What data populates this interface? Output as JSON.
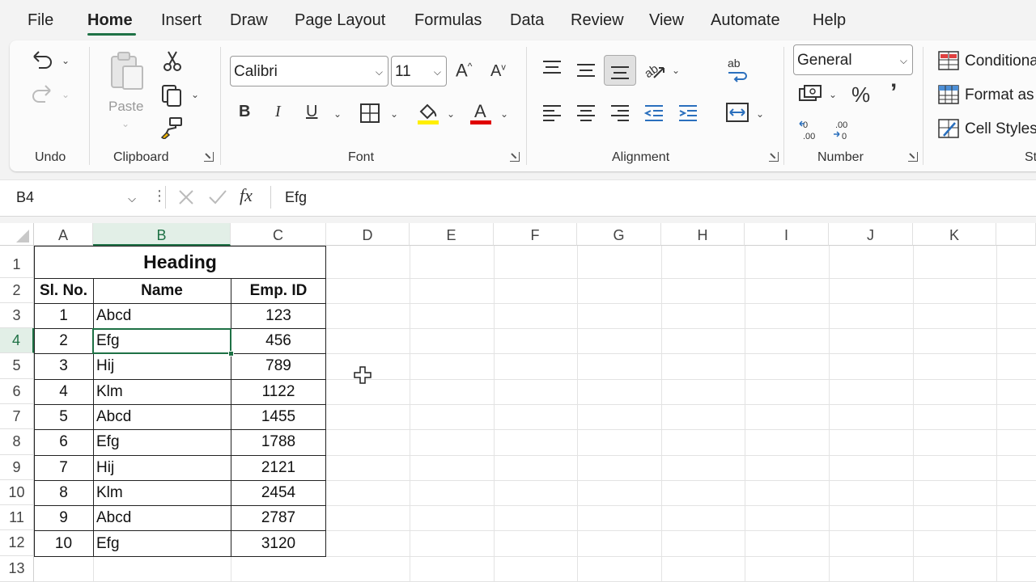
{
  "menu": [
    "File",
    "Home",
    "Insert",
    "Draw",
    "Page Layout",
    "Formulas",
    "Data",
    "Review",
    "View",
    "Automate",
    "Help"
  ],
  "ribbon": {
    "groups": {
      "undo": "Undo",
      "clipboard": "Clipboard",
      "font": "Font",
      "alignment": "Alignment",
      "number": "Number",
      "styles": "St"
    },
    "paste_label": "Paste",
    "font_name": "Calibri",
    "font_size": "11",
    "number_format": "General",
    "styles_items": [
      "Conditiona",
      "Format as",
      "Cell Styles"
    ],
    "bold": "B",
    "italic": "I",
    "underline": "U"
  },
  "formula_bar": {
    "name_box": "B4",
    "fx": "fx",
    "content": "Efg"
  },
  "columns": [
    "A",
    "B",
    "C",
    "D",
    "E",
    "F",
    "G",
    "H",
    "I",
    "J",
    "K"
  ],
  "rows": [
    "1",
    "2",
    "3",
    "4",
    "5",
    "6",
    "7",
    "8",
    "9",
    "10",
    "11",
    "12",
    "13"
  ],
  "sheet": {
    "heading": "Heading",
    "headers": [
      "Sl. No.",
      "Name",
      "Emp. ID"
    ],
    "data": [
      [
        "1",
        "Abcd",
        "123"
      ],
      [
        "2",
        "Efg",
        "456"
      ],
      [
        "3",
        "Hij",
        "789"
      ],
      [
        "4",
        "Klm",
        "1122"
      ],
      [
        "5",
        "Abcd",
        "1455"
      ],
      [
        "6",
        "Efg",
        "1788"
      ],
      [
        "7",
        "Hij",
        "2121"
      ],
      [
        "8",
        "Klm",
        "2454"
      ],
      [
        "9",
        "Abcd",
        "2787"
      ],
      [
        "10",
        "Efg",
        "3120"
      ]
    ]
  },
  "accent_color": "#1e7145"
}
